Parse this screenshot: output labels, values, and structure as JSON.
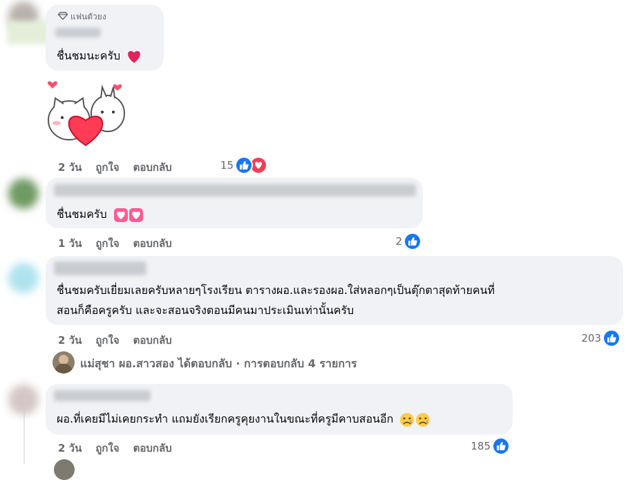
{
  "comments": [
    {
      "badge": "แฟนตัวยง",
      "text": "ชื่นชมนะครับ",
      "time": "2 วัน",
      "like": "ถูกใจ",
      "reply": "ตอบกลับ",
      "reactions": "15",
      "reaction_icons": [
        "like-icon",
        "love-icon"
      ],
      "text_emoji": "heart-emoji"
    },
    {
      "text": "ชื่นชมครับ",
      "time": "1 วัน",
      "like": "ถูกใจ",
      "reply": "ตอบกลับ",
      "reactions": "2",
      "reaction_icons": [
        "like-icon"
      ],
      "text_emoji": "pink-heart-emoji x2"
    },
    {
      "text_line1": "ชื่นชมครับเยี่ยมเลยครับหลายๆโรงเรียน ตารางผอ.และรองผอ.ใส่หลอกๆเป็นตุ๊กตาสุดท้ายคนที่",
      "text_line2": "สอนก็คือครูครับ และจะสอนจริงตอนมีคนมาประเมินเท่านั้นครับ",
      "time": "2 วัน",
      "like": "ถูกใจ",
      "reply": "ตอบกลับ",
      "reactions": "203",
      "reaction_icons": [
        "like-icon"
      ]
    },
    {
      "text": "ผอ.ที่เคยมีไม่เคยกระทำ แถมยังเรียกครูคุยงานในขณะที่ครูมีคาบสอนอีก",
      "time": "2 วัน",
      "like": "ถูกใจ",
      "reply": "ตอบกลับ",
      "reactions": "185",
      "reaction_icons": [
        "like-icon"
      ],
      "text_emoji": "sad-face-emoji x2"
    }
  ],
  "replies_summary": "แม่สุชา ผอ.สาวสอง ได้ตอบกลับ · การตอบกลับ 4 รายการ",
  "colors": {
    "bubble": "#f0f2f5",
    "like_blue": "#1877f2",
    "love_red": "#f33e58",
    "meta_gray": "#65676b"
  }
}
